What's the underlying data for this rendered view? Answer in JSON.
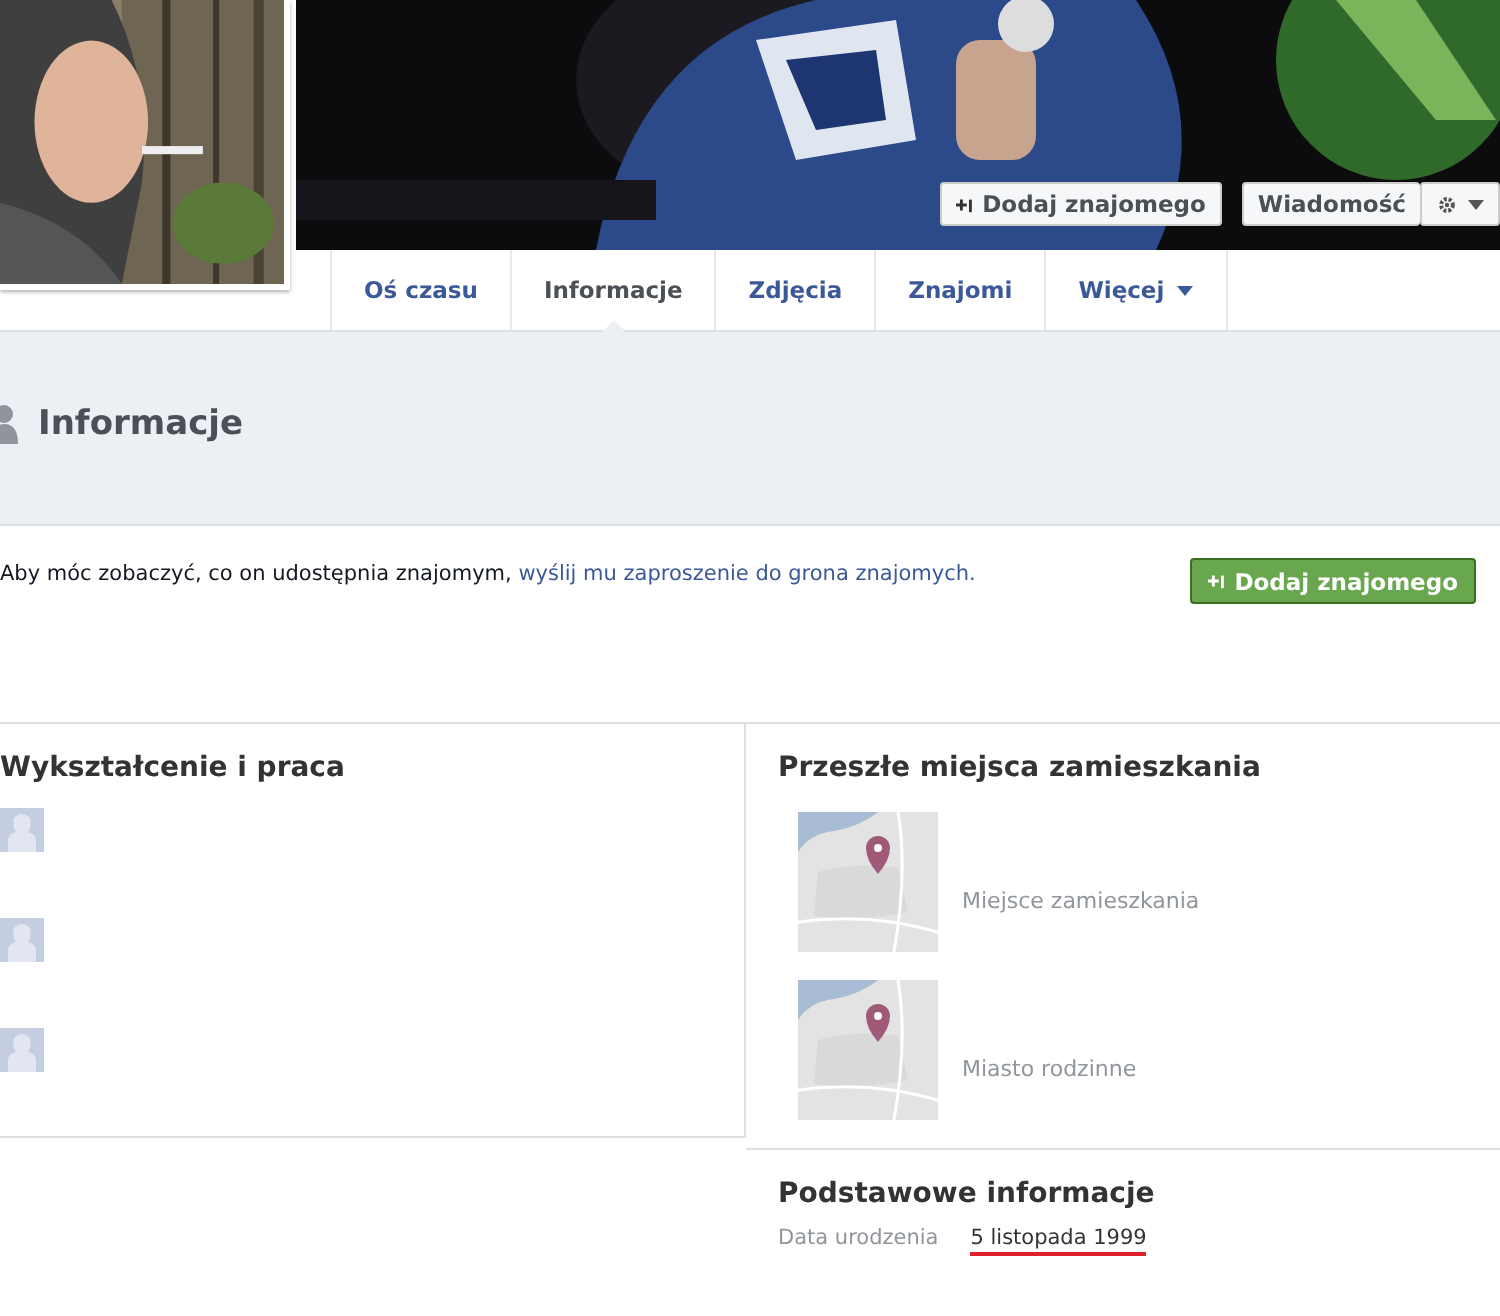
{
  "header": {
    "buttons": [
      {
        "kind": "add",
        "label": "Dodaj znajomego"
      },
      {
        "kind": "message",
        "label": "Wiadomość"
      },
      {
        "kind": "gear"
      }
    ]
  },
  "tabs": [
    {
      "label": "Oś czasu",
      "selected": false
    },
    {
      "label": "Informacje",
      "selected": true
    },
    {
      "label": "Zdjęcia",
      "selected": false
    },
    {
      "label": "Znajomi",
      "selected": false
    },
    {
      "label": "Więcej",
      "selected": false,
      "dropdown": true
    }
  ],
  "page_title": "Informacje",
  "notice": {
    "text": "Aby móc zobaczyć, co on udostępnia znajomym, ",
    "link": "wyślij mu zaproszenie do grona znajomych.",
    "button": "Dodaj znajomego"
  },
  "education": {
    "title": "Wykształcenie i praca",
    "items": [
      {
        "kind": "entry"
      },
      {
        "kind": "entry"
      },
      {
        "kind": "entry"
      }
    ]
  },
  "places": {
    "title": "Przeszłe miejsca zamieszkania",
    "items": [
      {
        "caption": "Miejsce zamieszkania"
      },
      {
        "caption": "Miasto rodzinne"
      }
    ]
  },
  "basic": {
    "title": "Podstawowe informacje",
    "rows": [
      {
        "label": "Data urodzenia",
        "value": "5 listopada 1999",
        "underlined": true
      }
    ]
  }
}
